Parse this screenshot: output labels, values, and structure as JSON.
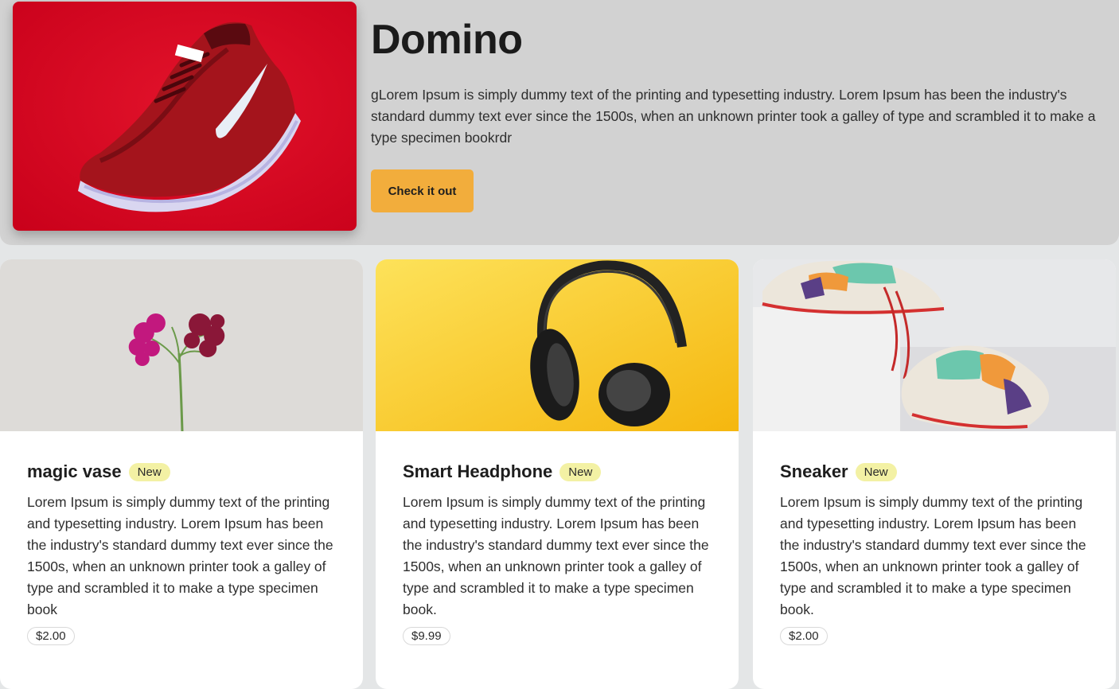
{
  "hero": {
    "title": "Domino",
    "description": "gLorem Ipsum is simply dummy text of the printing and typesetting industry. Lorem Ipsum has been the industry's standard dummy text ever since the 1500s, when an unknown printer took a galley of type and scrambled it to make a type specimen bookrdr",
    "button_label": "Check it out",
    "image_logo_text": "NIKE",
    "button_color": "#f2ad3c",
    "image_bg": "#d0021b"
  },
  "products": [
    {
      "title": "magic vase",
      "badge": "New",
      "description": "Lorem Ipsum is simply dummy text of the printing and typesetting industry. Lorem Ipsum has been the industry's standard dummy text ever since the 1500s, when an unknown printer took a galley of type and scrambled it to make a type specimen book",
      "price": "$2.00",
      "image": "flower-image"
    },
    {
      "title": "Smart Headphone",
      "badge": "New",
      "description": "Lorem Ipsum is simply dummy text of the printing and typesetting industry. Lorem Ipsum has been the industry's standard dummy text ever since the 1500s, when an unknown printer took a galley of type and scrambled it to make a type specimen book.",
      "price": "$9.99",
      "image": "headphone-image"
    },
    {
      "title": "Sneaker",
      "badge": "New",
      "description": "Lorem Ipsum is simply dummy text of the printing and typesetting industry. Lorem Ipsum has been the industry's standard dummy text ever since the 1500s, when an unknown printer took a galley of type and scrambled it to make a type specimen book.",
      "price": "$2.00",
      "image": "sneakers-image"
    }
  ],
  "colors": {
    "badge_bg": "#f3f1a4",
    "page_bg": "#e4e6e7",
    "hero_bg": "#d2d2d2"
  }
}
